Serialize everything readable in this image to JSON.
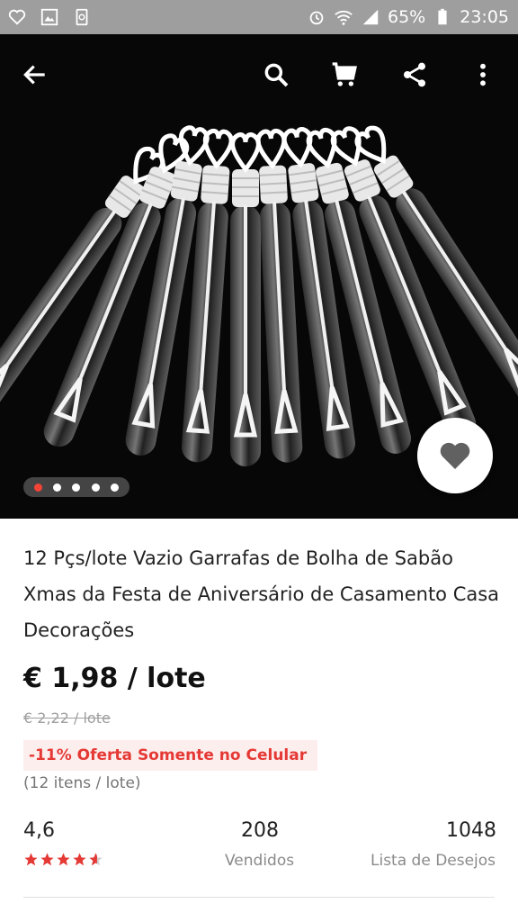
{
  "status_bar": {
    "battery": "65%",
    "time": "23:05",
    "icons": [
      "heart-outline-icon",
      "gallery-icon",
      "recycle-icon",
      "alarm-icon",
      "wifi-icon",
      "signal-icon",
      "battery-icon"
    ]
  },
  "toolbar": {
    "icons": [
      "back-arrow-icon",
      "search-icon",
      "cart-icon",
      "share-icon",
      "more-vert-icon"
    ]
  },
  "gallery": {
    "image_count": 5,
    "active_index": 0
  },
  "product": {
    "title": "12 Pçs/lote Vazio Garrafas de Bolha de Sabão Xmas da Festa de Aniversário de Casamento Casa Decorações",
    "price": "€ 1,98 / lote",
    "old_price": "€ 2,22 / lote",
    "promo": "-11% Oferta Somente no Celular",
    "lot_info": "(12 itens / lote)"
  },
  "stats": {
    "rating": "4,6",
    "rating_stars": 4.6,
    "sold": "208",
    "sold_label": "Vendidos",
    "wishlist": "1048",
    "wishlist_label": "Lista de Desejos"
  },
  "colors": {
    "accent_red": "#e53935",
    "status_bar": "#9e9e9e",
    "hero_bg": "#070707"
  }
}
